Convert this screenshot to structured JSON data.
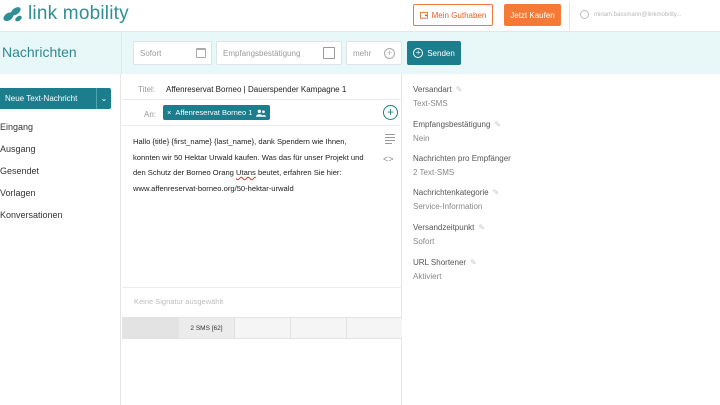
{
  "topbar": {
    "logo_text": "link mobility",
    "guthaben_label": "Mein Guthaben",
    "kaufen_label": "Jetzt Kaufen",
    "user_email": "miriam.bassmann@linkmobility..."
  },
  "header": {
    "page_title": "Nachrichten",
    "sofort_value": "Sofort",
    "empfang_label": "Empfangsbestätigung",
    "mehr_label": "mehr",
    "senden_label": "Senden"
  },
  "sidebar": {
    "new_button_label": "Neue Text-Nachricht",
    "items": [
      {
        "label": "Eingang"
      },
      {
        "label": "Ausgang"
      },
      {
        "label": "Gesendet"
      },
      {
        "label": "Vorlagen"
      },
      {
        "label": "Konversationen"
      }
    ]
  },
  "editor": {
    "title_label": "Titel:",
    "title_value": "Affenreservat Borneo | Dauerspender Kampagne 1",
    "an_label": "An:",
    "recipient_chip": "Affenreservat Borneo 1",
    "body_part1": "Hallo {title} {first_name} {last_name}, dank Spendern wie Ihnen, konnten wir 50 Hektar Urwald kaufen. Was das für unser Projekt und den Schutz der Borneo Orang ",
    "body_misspelled": "Utans",
    "body_part2": " beutet, erfahren Sie hier: www.affenreservat-borneo.org/50-hektar-urwald",
    "signature_placeholder": "Keine Signatur ausgewählt",
    "sms_count": "2 SMS [62]"
  },
  "properties": [
    {
      "label": "Versandart",
      "value": "Text-SMS"
    },
    {
      "label": "Empfangsbestätigung",
      "value": "Nein"
    },
    {
      "label": "Nachrichten pro Empfänger",
      "value": "2 Text-SMS",
      "editable": false
    },
    {
      "label": "Nachrichtenkategorie",
      "value": "Service-Information"
    },
    {
      "label": "Versandzeitpunkt",
      "value": "Sofort"
    },
    {
      "label": "URL Shortener",
      "value": "Aktiviert"
    }
  ],
  "colors": {
    "brand_teal": "#1c7d8c",
    "accent_orange": "#f47a36",
    "header_band": "#e8f7f8"
  }
}
